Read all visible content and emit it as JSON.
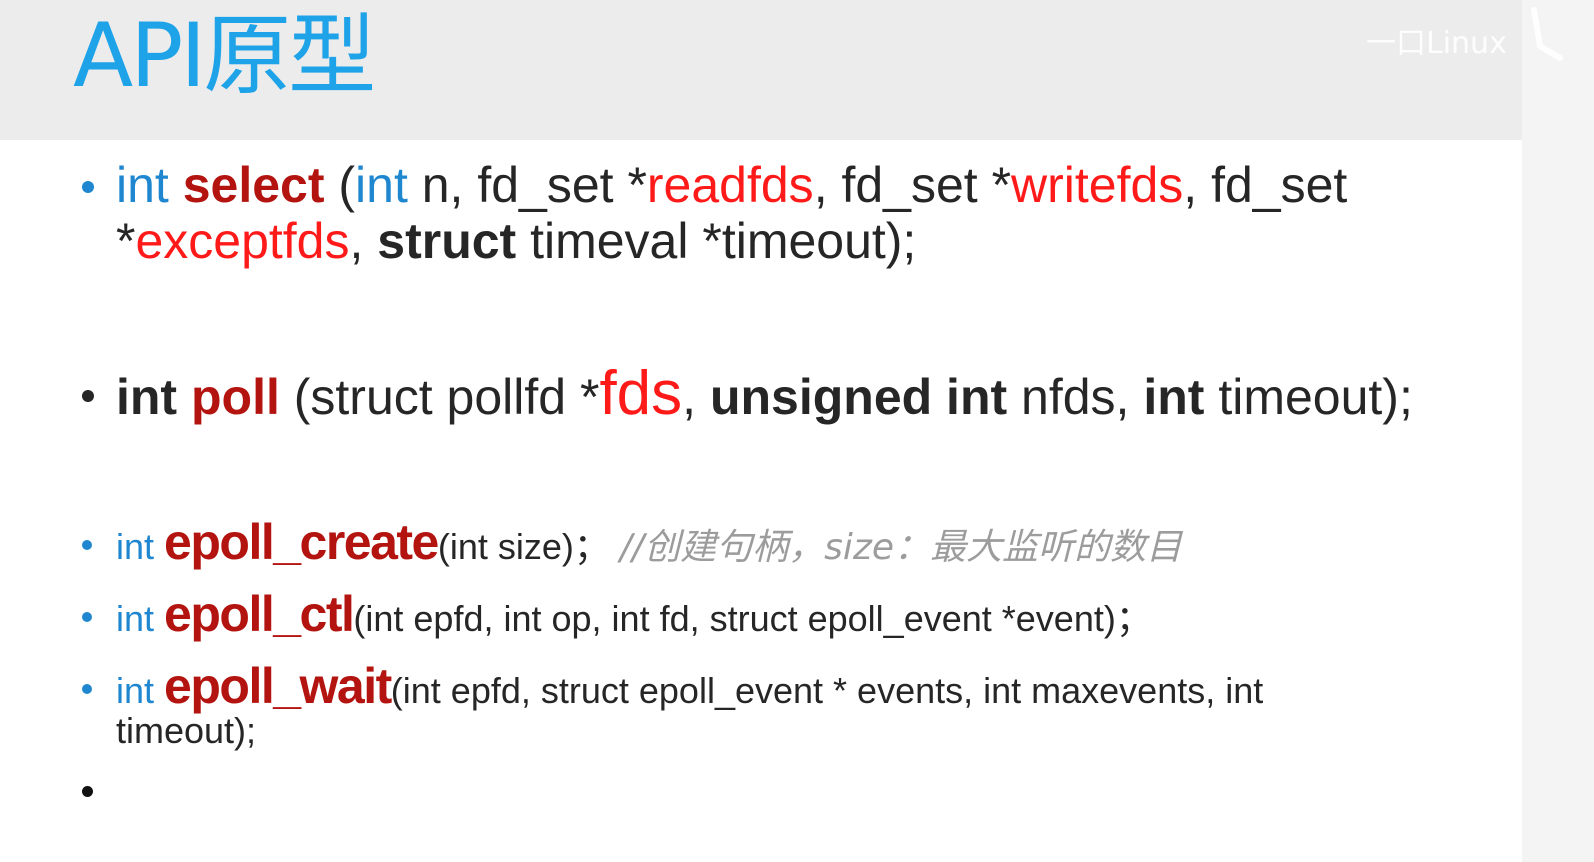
{
  "slide": {
    "title": "API原型",
    "watermark": "一口Linux"
  },
  "bullets": {
    "select": {
      "kw_int": "int",
      "fn_name": "select",
      "p1": " (",
      "kw_int2": "int",
      "p2": " n, fd_set *",
      "arg_readfds": "readfds",
      "p3": ", fd_set *",
      "arg_writefds": "writefds",
      "p4": ", fd_set",
      "p5": "*",
      "arg_exceptfds": "exceptfds",
      "p6": ", ",
      "kw_struct": "struct",
      "p7": " timeval *timeout);"
    },
    "poll": {
      "kw_int": "int",
      "fn_name": "poll",
      "p1": " (struct pollfd *",
      "arg_fds": "fds",
      "p2": ", ",
      "kw_unsigned_int": "unsigned int",
      "p3": " nfds, ",
      "kw_int2": "int",
      "p4": " timeout);"
    },
    "epoll_create": {
      "kw_int": "int",
      "fn_name": "epoll_create",
      "params": "(int size)；",
      "comment": "//创建句柄，size：最大监听的数目"
    },
    "epoll_ctl": {
      "kw_int": "int",
      "fn_name": "epoll_ctl",
      "params": "(int epfd, int op, int fd, struct epoll_event *event)；"
    },
    "epoll_wait": {
      "kw_int": "int",
      "fn_name": "epoll_wait",
      "params_line1": "(int epfd, struct epoll_event * events, int maxevents, int",
      "params_line2": "timeout);"
    }
  },
  "colors": {
    "title": "#1fa3e8",
    "keyword": "#1f87cf",
    "function_name": "#b3140f",
    "argument": "#ff1a1a",
    "comment": "#9c9c9c",
    "header_band": "#ececec"
  }
}
